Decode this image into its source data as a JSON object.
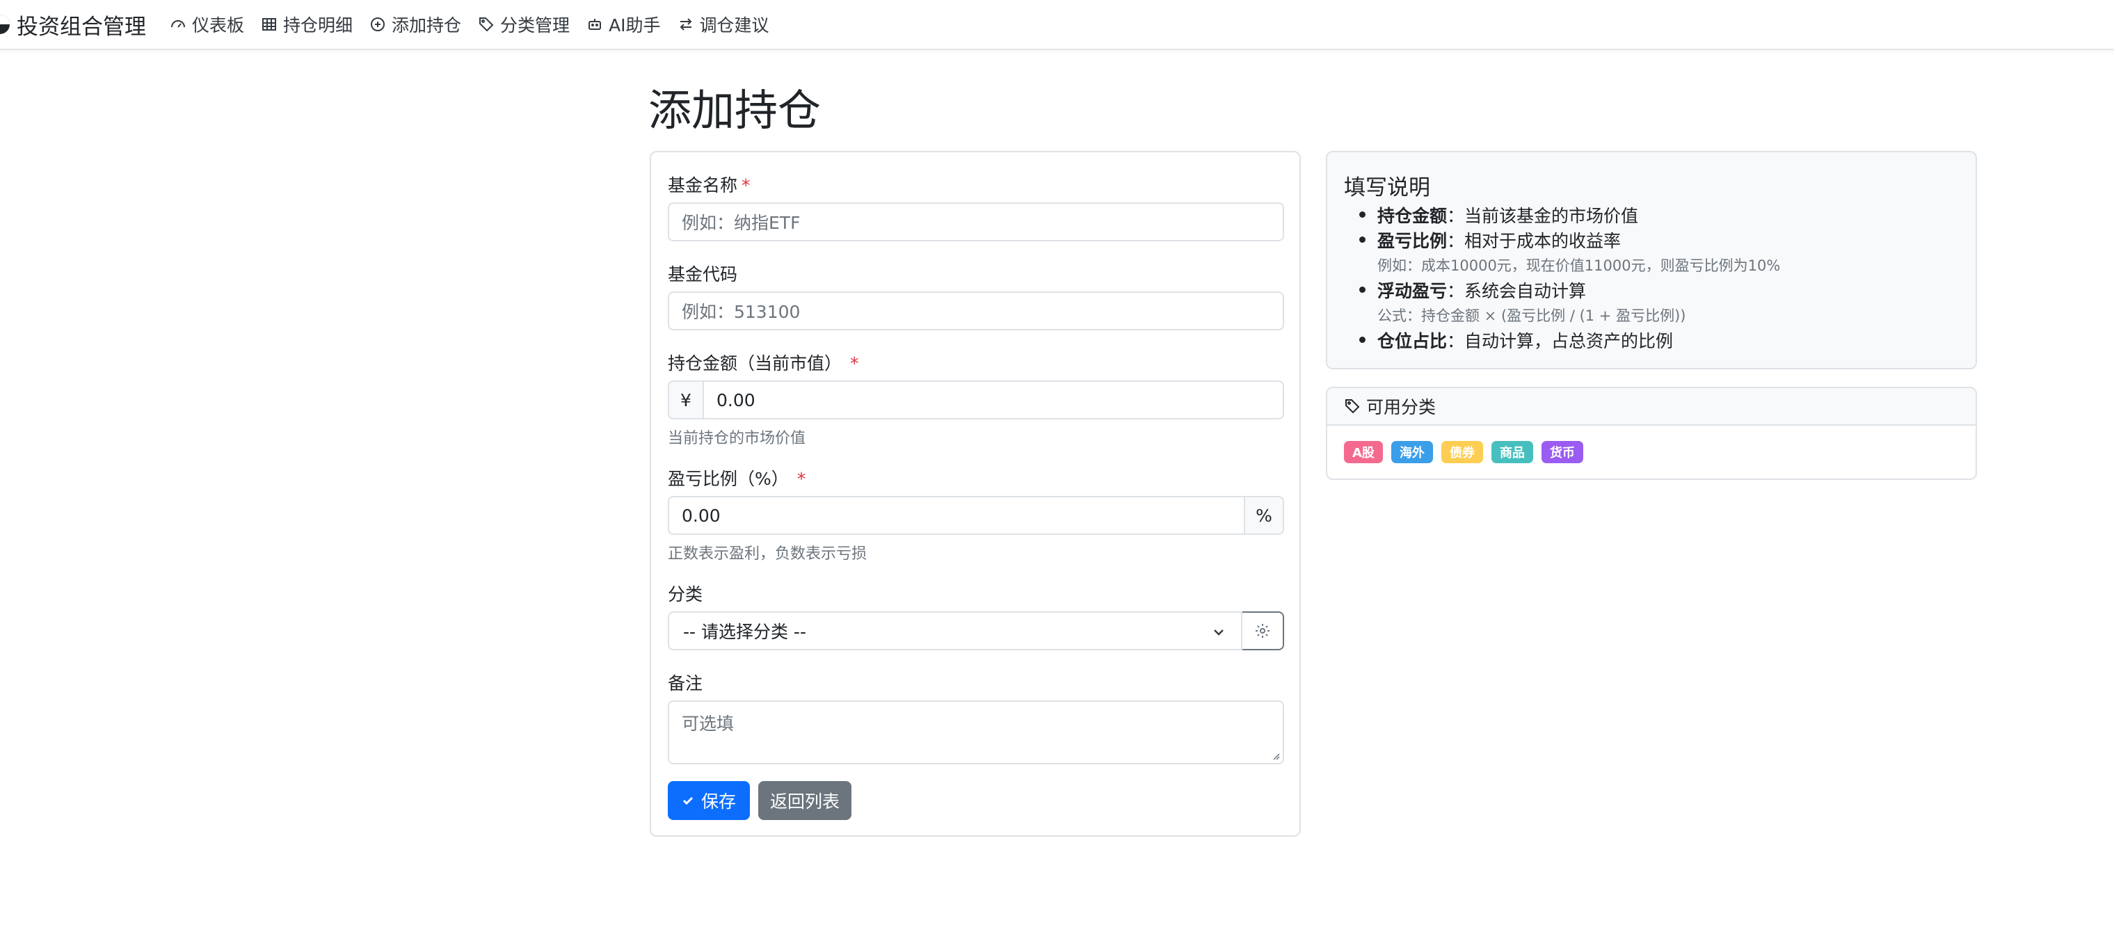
{
  "navbar": {
    "brand": "投资组合管理",
    "items": [
      {
        "label": "仪表板",
        "icon": "speedometer-icon"
      },
      {
        "label": "持仓明细",
        "icon": "table-icon"
      },
      {
        "label": "添加持仓",
        "icon": "plus-circle-icon"
      },
      {
        "label": "分类管理",
        "icon": "tag-icon"
      },
      {
        "label": "AI助手",
        "icon": "robot-icon"
      },
      {
        "label": "调仓建议",
        "icon": "arrow-left-right-icon"
      }
    ]
  },
  "page": {
    "title": "添加持仓"
  },
  "form": {
    "fund_name": {
      "label": "基金名称",
      "required": "*",
      "placeholder": "例如：纳指ETF"
    },
    "fund_code": {
      "label": "基金代码",
      "placeholder": "例如：513100"
    },
    "amount": {
      "label": "持仓金额（当前市值）",
      "required": "*",
      "prefix": "¥",
      "value": "0.00",
      "help": "当前持仓的市场价值"
    },
    "pnl_ratio": {
      "label": "盈亏比例（%）",
      "required": "*",
      "value": "0.00",
      "suffix": "%",
      "help": "正数表示盈利，负数表示亏损"
    },
    "category": {
      "label": "分类",
      "selected": "-- 请选择分类 --"
    },
    "note": {
      "label": "备注",
      "placeholder": "可选填"
    },
    "save_label": "保存",
    "back_label": "返回列表"
  },
  "help_card": {
    "title": "填写说明",
    "items": [
      {
        "term": "持仓金额",
        "desc": "：当前该基金的市场价值"
      },
      {
        "term": "盈亏比例",
        "desc": "：相对于成本的收益率",
        "sub": "例如：成本10000元，现在价值11000元，则盈亏比例为10%"
      },
      {
        "term": "浮动盈亏",
        "desc": "：系统会自动计算",
        "sub": "公式：持仓金额 × (盈亏比例 / (1 + 盈亏比例))"
      },
      {
        "term": "仓位占比",
        "desc": "：自动计算，占总资产的比例"
      }
    ]
  },
  "categories_card": {
    "title": "可用分类",
    "badges": [
      {
        "label": "A股",
        "color": "#f46a8e"
      },
      {
        "label": "海外",
        "color": "#3b9ee8"
      },
      {
        "label": "债券",
        "color": "#fdce53"
      },
      {
        "label": "商品",
        "color": "#48bfbf"
      },
      {
        "label": "货币",
        "color": "#9a5cf2"
      }
    ]
  }
}
